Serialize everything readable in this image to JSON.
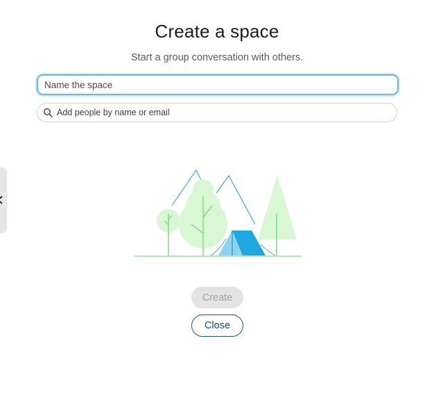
{
  "dialog": {
    "title": "Create a space",
    "subtitle": "Start a group conversation with others."
  },
  "name_field": {
    "placeholder": "Name the space",
    "value": ""
  },
  "people_field": {
    "placeholder": "Add people by name or email",
    "value": "",
    "icon": "search-icon"
  },
  "side_tab": {
    "icon": "chevron-left-icon"
  },
  "illustration": {
    "subject": "campsite-illustration",
    "colors": {
      "mountain_outline": "#2aa7d8",
      "tree_light": "#d9f7d4",
      "tree_stem": "#6fdc6f",
      "tent": "#1ea7e0",
      "tent_door": "#8fd3ee",
      "ground": "#7ddc7d"
    }
  },
  "actions": {
    "create_label": "Create",
    "close_label": "Close",
    "create_enabled": false
  },
  "colors": {
    "focus_border": "#6ab4e6",
    "close_text": "#0b4f6c",
    "disabled_bg": "#e3e3e3",
    "disabled_text": "#a4a4a4"
  }
}
